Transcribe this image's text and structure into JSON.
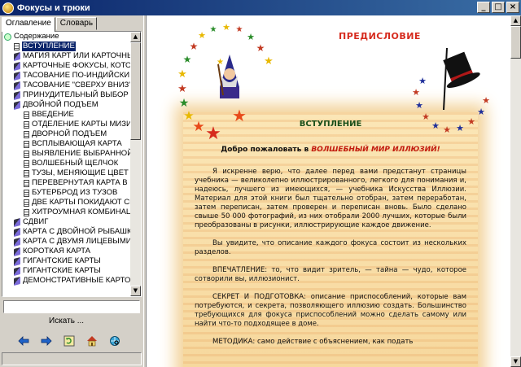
{
  "window": {
    "title": "Фокусы и трюки",
    "buttons": [
      "_",
      "□",
      "×"
    ]
  },
  "tabs": [
    {
      "label": "Оглавление",
      "active": true
    },
    {
      "label": "Словарь",
      "active": false
    }
  ],
  "tree": {
    "root": "Содержание",
    "items": [
      {
        "label": "ВСТУПЛЕНИЕ",
        "icon": "page-icon",
        "level": 1,
        "selected": true
      },
      {
        "label": "МАГИЯ КАРТ ИЛИ КАРТОЧНЫЕ",
        "icon": "book-icon",
        "level": 1
      },
      {
        "label": "КАРТОЧНЫЕ ФОКУСЫ, КОТОР",
        "icon": "book-icon",
        "level": 1
      },
      {
        "label": "ТАСОВАНИЕ ПО-ИНДИЙСКИ",
        "icon": "book-icon",
        "level": 1
      },
      {
        "label": "ТАСОВАНИЕ \"СВЕРХУ ВНИЗ\"",
        "icon": "book-icon",
        "level": 1
      },
      {
        "label": "ПРИНУДИТЕЛЬНЫЙ ВЫБОР",
        "icon": "book-icon",
        "level": 1
      },
      {
        "label": "ДВОЙНОЙ ПОДЪЕМ",
        "icon": "book-icon",
        "level": 1
      },
      {
        "label": "ВВЕДЕНИЕ",
        "icon": "page-icon",
        "level": 2
      },
      {
        "label": "ОТДЕЛЕНИЕ КАРТЫ МИЗИ",
        "icon": "page-icon",
        "level": 2
      },
      {
        "label": "ДВОРНОЙ ПОДЪЕМ",
        "icon": "page-icon",
        "level": 2
      },
      {
        "label": "ВСПЛЫВАЮЩАЯ КАРТА",
        "icon": "page-icon",
        "level": 2
      },
      {
        "label": "ВЫЯВЛЕНИЕ ВЫБРАННОЙ",
        "icon": "page-icon",
        "level": 2
      },
      {
        "label": "ВОЛШЕБНЫЙ ЩЕЛЧОК",
        "icon": "page-icon",
        "level": 2
      },
      {
        "label": "ТУЗЫ, МЕНЯЮЩИЕ ЦВЕТ",
        "icon": "page-icon",
        "level": 2
      },
      {
        "label": "ПЕРЕВЕРНУТАЯ КАРТА В",
        "icon": "page-icon",
        "level": 2
      },
      {
        "label": "БУТЕРБРОД ИЗ ТУЗОВ",
        "icon": "page-icon",
        "level": 2
      },
      {
        "label": "ДВЕ КАРТЫ ПОКИДАЮТ СВО",
        "icon": "page-icon",
        "level": 2
      },
      {
        "label": "ХИТРОУМНАЯ КОМБИНАЦИ",
        "icon": "page-icon",
        "level": 2
      },
      {
        "label": "СДВИГ",
        "icon": "book-icon",
        "level": 1
      },
      {
        "label": "КАРТА С ДВОЙНОЙ РЫБАШКОЙ",
        "icon": "book-icon",
        "level": 1
      },
      {
        "label": "КАРТА С ДВУМЯ ЛИЦЕВЫМИ С",
        "icon": "book-icon",
        "level": 1
      },
      {
        "label": "КОРОТКАЯ КАРТА",
        "icon": "book-icon",
        "level": 1
      },
      {
        "label": "ГИГАНТСКИЕ КАРТЫ",
        "icon": "book-icon",
        "level": 1
      },
      {
        "label": "ГИГАНТСКИЕ КАРТЫ",
        "icon": "book-icon",
        "level": 1
      },
      {
        "label": "ДЕМОНСТРАТИВНЫЕ КАРТО",
        "icon": "book-icon",
        "level": 1
      }
    ]
  },
  "search": {
    "value": "",
    "button_label": "Искать ..."
  },
  "toolbar": [
    "back-arrow-icon",
    "forward-arrow-icon",
    "refresh-icon",
    "home-icon",
    "globe-search-icon"
  ],
  "content": {
    "preface": "ПРЕДИСЛОВИЕ",
    "section_title": "ВСТУПЛЕНИЕ",
    "welcome_prefix": "Добро пожаловать в ",
    "welcome_em": "ВОЛШЕБНЫЙ МИР ИЛЛЮЗИЙ!",
    "paragraphs": [
      "Я искренне верю, что далее перед вами предстанут страницы учебника — великолепно иллюстрированного, легкого для понимания и, надеюсь, лучшего из имеющихся, — учебника Искусства Иллюзии. Материал для этой книги был тщательно отобран, затем переработан, затем переписан, затем проверен и переписан вновь. Было сделано свыше 50 000 фотографий, из них отобрали 2000 лучших, которые были преобразованы в рисунки, иллюстрирующие каждое движение.",
      "Вы увидите, что описание каждого фокуса состоит из нескольких разделов.",
      "ВПЕЧАТЛЕНИЕ: то, что видит зритель, — тайна — чудо, которое сотворили вы, иллюзионист.",
      "СЕКРЕТ И ПОДГОТОВКА: описание приспособлений, которые вам потребуются, и секрета, позволяющего иллюзию создать. Большинство требующихся для фокуса приспособлений можно сделать самому или найти что-то подходящее в доме.",
      "МЕТОДИКА: само действие с объяснением, как подать"
    ]
  },
  "colors": {
    "titlebar_start": "#0a246a",
    "heading_red": "#d62b1e",
    "section_green": "#1a4f1a",
    "parchment": "#f6d79c",
    "selection": "#0a246a"
  }
}
